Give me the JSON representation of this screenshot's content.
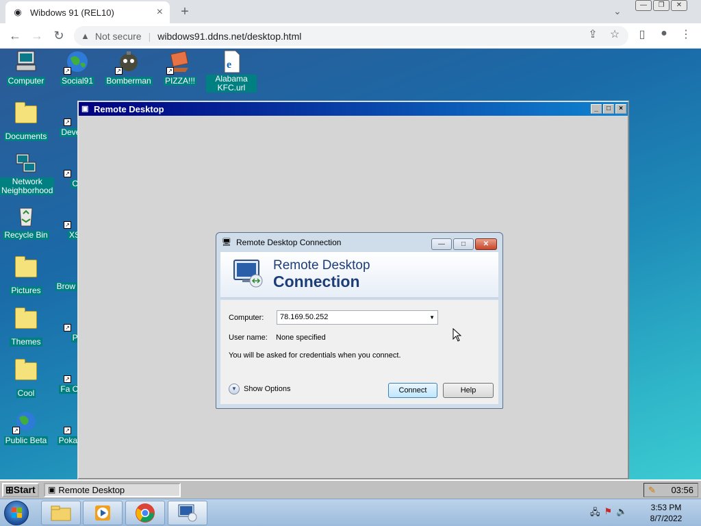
{
  "browser": {
    "tab_title": "Wibdows 91 (REL10)",
    "new_tab": "+",
    "security_label": "Not secure",
    "url": "wibdows91.ddns.net/desktop.html"
  },
  "desktop": {
    "icons": [
      {
        "label": "Computer"
      },
      {
        "label": "Social91"
      },
      {
        "label": "Bomberman"
      },
      {
        "label": "PIZZA!!!"
      },
      {
        "label": "Alabama KFC.url"
      },
      {
        "label": "Documents"
      },
      {
        "label": "Deve Ins"
      },
      {
        "label": "Network Neighborhood"
      },
      {
        "label": "Ch"
      },
      {
        "label": "Recycle Bin"
      },
      {
        "label": "XSS"
      },
      {
        "label": "Pictures"
      },
      {
        "label": "Brow Interv"
      },
      {
        "label": "Themes"
      },
      {
        "label": "Pa"
      },
      {
        "label": "Cool"
      },
      {
        "label": "Fa Comp"
      },
      {
        "label": "Public Beta"
      },
      {
        "label": "Poka Platf"
      }
    ]
  },
  "remote_window": {
    "title": "Remote Desktop"
  },
  "rdc_dialog": {
    "title": "Remote Desktop Connection",
    "banner_line1": "Remote Desktop",
    "banner_line2": "Connection",
    "computer_label": "Computer:",
    "computer_value": "78.169.50.252",
    "username_label": "User name:",
    "username_value": "None specified",
    "info_text": "You will be asked for credentials when you connect.",
    "show_options": "Show Options",
    "connect_button": "Connect",
    "help_button": "Help"
  },
  "wibdows_taskbar": {
    "start_label": "Start",
    "task_label": "Remote Desktop",
    "clock": "03:56"
  },
  "win7_taskbar": {
    "time": "3:53 PM",
    "date": "8/7/2022"
  }
}
